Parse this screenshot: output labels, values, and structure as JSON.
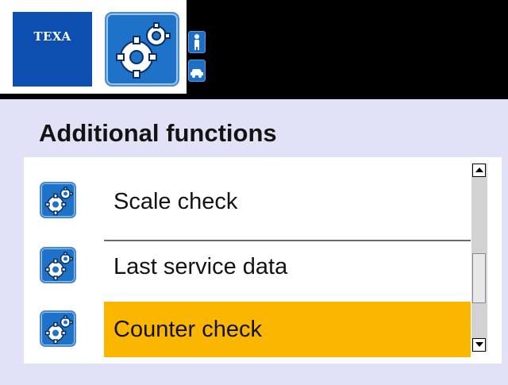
{
  "header": {
    "brand_logo_text": "TEXA",
    "main_icon": "gears-icon",
    "side_buttons": [
      {
        "icon": "person-icon"
      },
      {
        "icon": "car-icon"
      }
    ]
  },
  "page": {
    "title": "Additional functions"
  },
  "list": {
    "items": [
      {
        "label": "Scale check",
        "icon": "gears-icon",
        "selected": false
      },
      {
        "label": "Last service data",
        "icon": "gears-icon",
        "selected": false
      },
      {
        "label": "Counter check",
        "icon": "gears-icon",
        "selected": true
      }
    ]
  },
  "scrollbar": {
    "position_fraction": 0.55
  },
  "colors": {
    "background": "#e1e1f7",
    "brand_blue": "#0c4fb0",
    "icon_blue": "#1e73c8",
    "selection": "#fbb600",
    "header_black": "#000000"
  }
}
